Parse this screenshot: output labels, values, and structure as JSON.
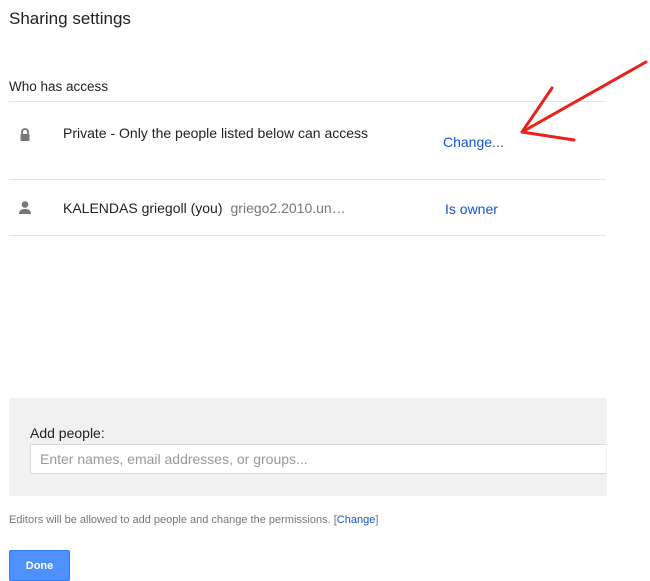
{
  "dialog": {
    "title": "Sharing settings",
    "section_label": "Who has access"
  },
  "access_rows": [
    {
      "icon": "lock-icon",
      "text": "Private - Only the people listed below can access",
      "email": "",
      "action": "Change..."
    },
    {
      "icon": "person-icon",
      "text": "KALENDAS griegoll (you)",
      "email": "griego2.2010.un…",
      "action": "Is owner"
    }
  ],
  "add_people": {
    "label": "Add people:",
    "placeholder": "Enter names, email addresses, or groups...",
    "value": ""
  },
  "footnote": {
    "text": "Editors will be allowed to add people and change the permissions.",
    "open_bracket": "[",
    "link": "Change",
    "close_bracket": "]"
  },
  "done_button": "Done",
  "colors": {
    "link": "#1155cc",
    "primary_button": "#4d90fe",
    "panel_bg": "#f1f1f1",
    "annotation_arrow": "#e8231c"
  }
}
